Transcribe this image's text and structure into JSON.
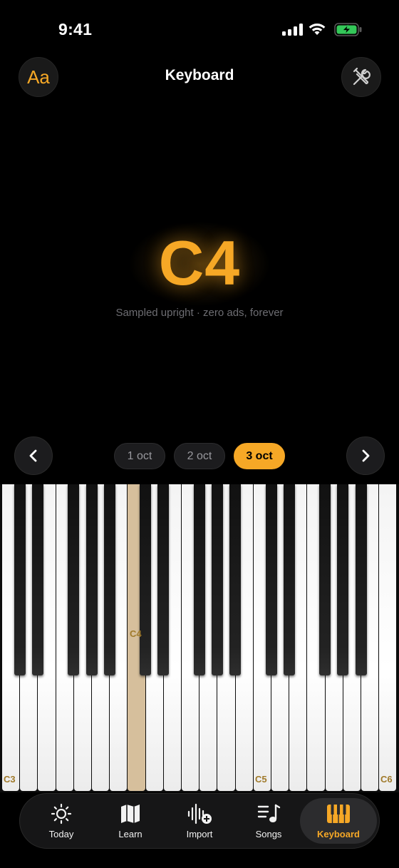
{
  "status": {
    "time": "9:41"
  },
  "header": {
    "title": "Keyboard",
    "font_button_label": "Aa",
    "tools_icon": "tools-icon"
  },
  "note_display": {
    "note": "C4",
    "subtitle": "Sampled upright · zero ads, forever"
  },
  "octave_selector": {
    "options": [
      "1 oct",
      "2 oct",
      "3 oct"
    ],
    "selected": "3 oct"
  },
  "keyboard": {
    "range": "C3–C6",
    "active_key": "C4",
    "active_key_label": "C4",
    "labels": {
      "c3": "C3",
      "c5": "C5",
      "c6": "C6"
    }
  },
  "tab_bar": {
    "items": [
      {
        "label": "Today",
        "icon": "sun-icon"
      },
      {
        "label": "Learn",
        "icon": "map-icon"
      },
      {
        "label": "Import",
        "icon": "waveform-plus-icon"
      },
      {
        "label": "Songs",
        "icon": "music-list-icon"
      },
      {
        "label": "Keyboard",
        "icon": "piano-keys-icon"
      }
    ],
    "selected": "Keyboard"
  },
  "colors": {
    "accent": "#f6a826",
    "background": "#000000",
    "active_key": "#d6bf9c"
  }
}
